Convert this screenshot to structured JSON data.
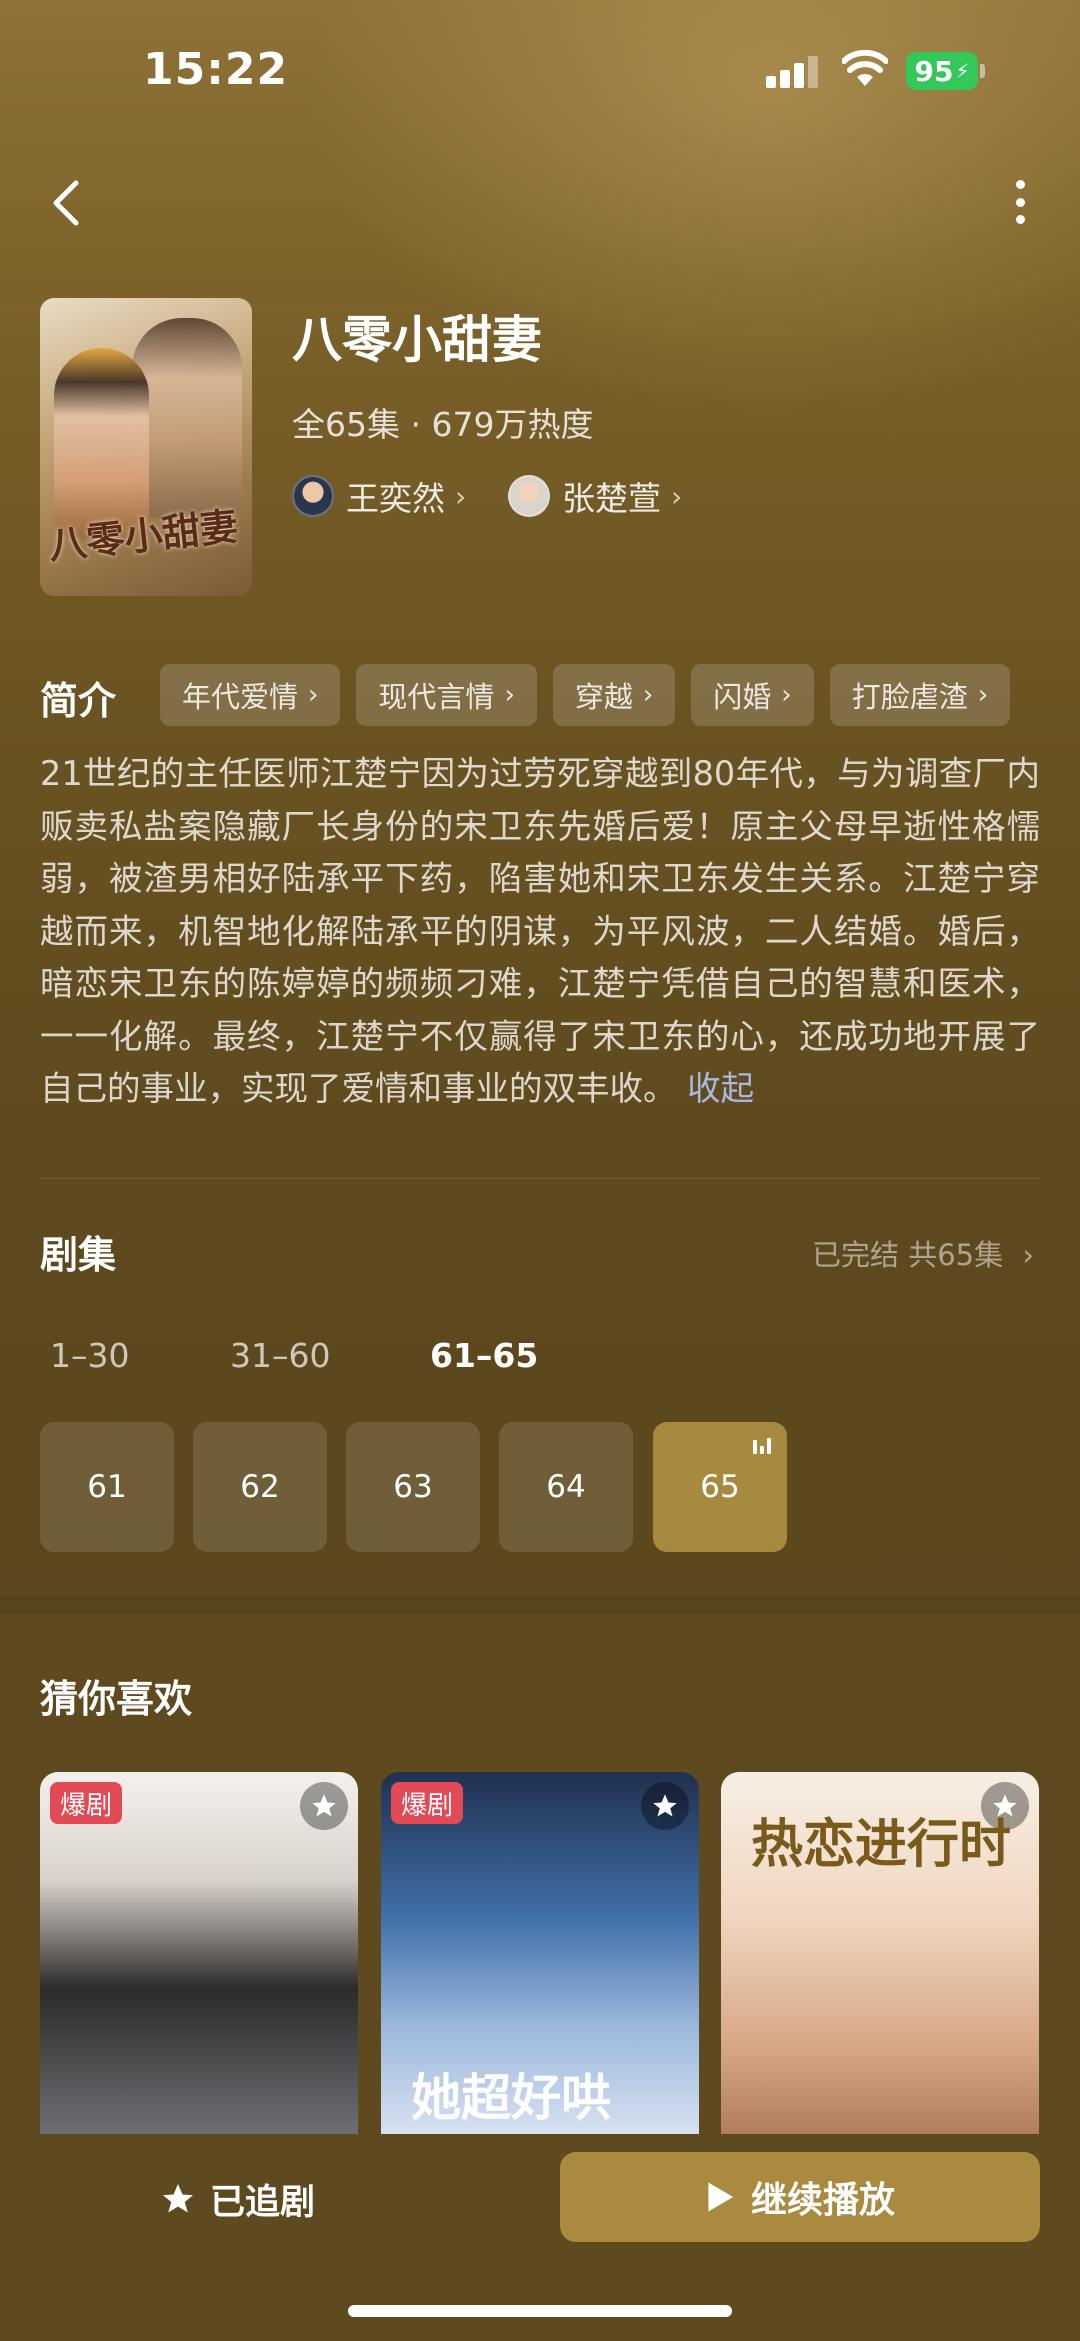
{
  "status_bar": {
    "time": "15:22",
    "battery": "95"
  },
  "show": {
    "title": "八零小甜妻",
    "meta": "全65集 · 679万热度",
    "poster_title": "八零小甜妻",
    "actors": [
      {
        "name": "王奕然"
      },
      {
        "name": "张楚萱"
      }
    ]
  },
  "intro": {
    "heading": "简介",
    "tags": [
      "年代爱情",
      "现代言情",
      "穿越",
      "闪婚",
      "打脸虐渣"
    ],
    "synopsis": "21世纪的主任医师江楚宁因为过劳死穿越到80年代，与为调查厂内贩卖私盐案隐藏厂长身份的宋卫东先婚后爱！原主父母早逝性格懦弱，被渣男相好陆承平下药，陷害她和宋卫东发生关系。江楚宁穿越而来，机智地化解陆承平的阴谋，为平风波，二人结婚。婚后，暗恋宋卫东的陈婷婷的频频刁难，江楚宁凭借自己的智慧和医术，一一化解。最终，江楚宁不仅赢得了宋卫东的心，还成功地开展了自己的事业，实现了爱情和事业的双丰收。",
    "collapse": "收起"
  },
  "episodes": {
    "heading": "剧集",
    "status": "已完结 共65集",
    "ranges": [
      "1–30",
      "31–60",
      "61–65"
    ],
    "active_range": "61–65",
    "items": [
      "61",
      "62",
      "63",
      "64",
      "65"
    ],
    "playing": "65"
  },
  "recommend": {
    "heading": "猜你喜欢",
    "cards": [
      {
        "badge": "爆剧",
        "text": ""
      },
      {
        "badge": "爆剧",
        "text": "她超好哄"
      },
      {
        "badge": "",
        "text": "热恋进行时"
      }
    ]
  },
  "bottom": {
    "follow_label": "已追剧",
    "play_label": "继续播放"
  },
  "colors": {
    "accent": "#a98a3f",
    "background": "#5e4a1e",
    "badge": "#e24b55"
  }
}
